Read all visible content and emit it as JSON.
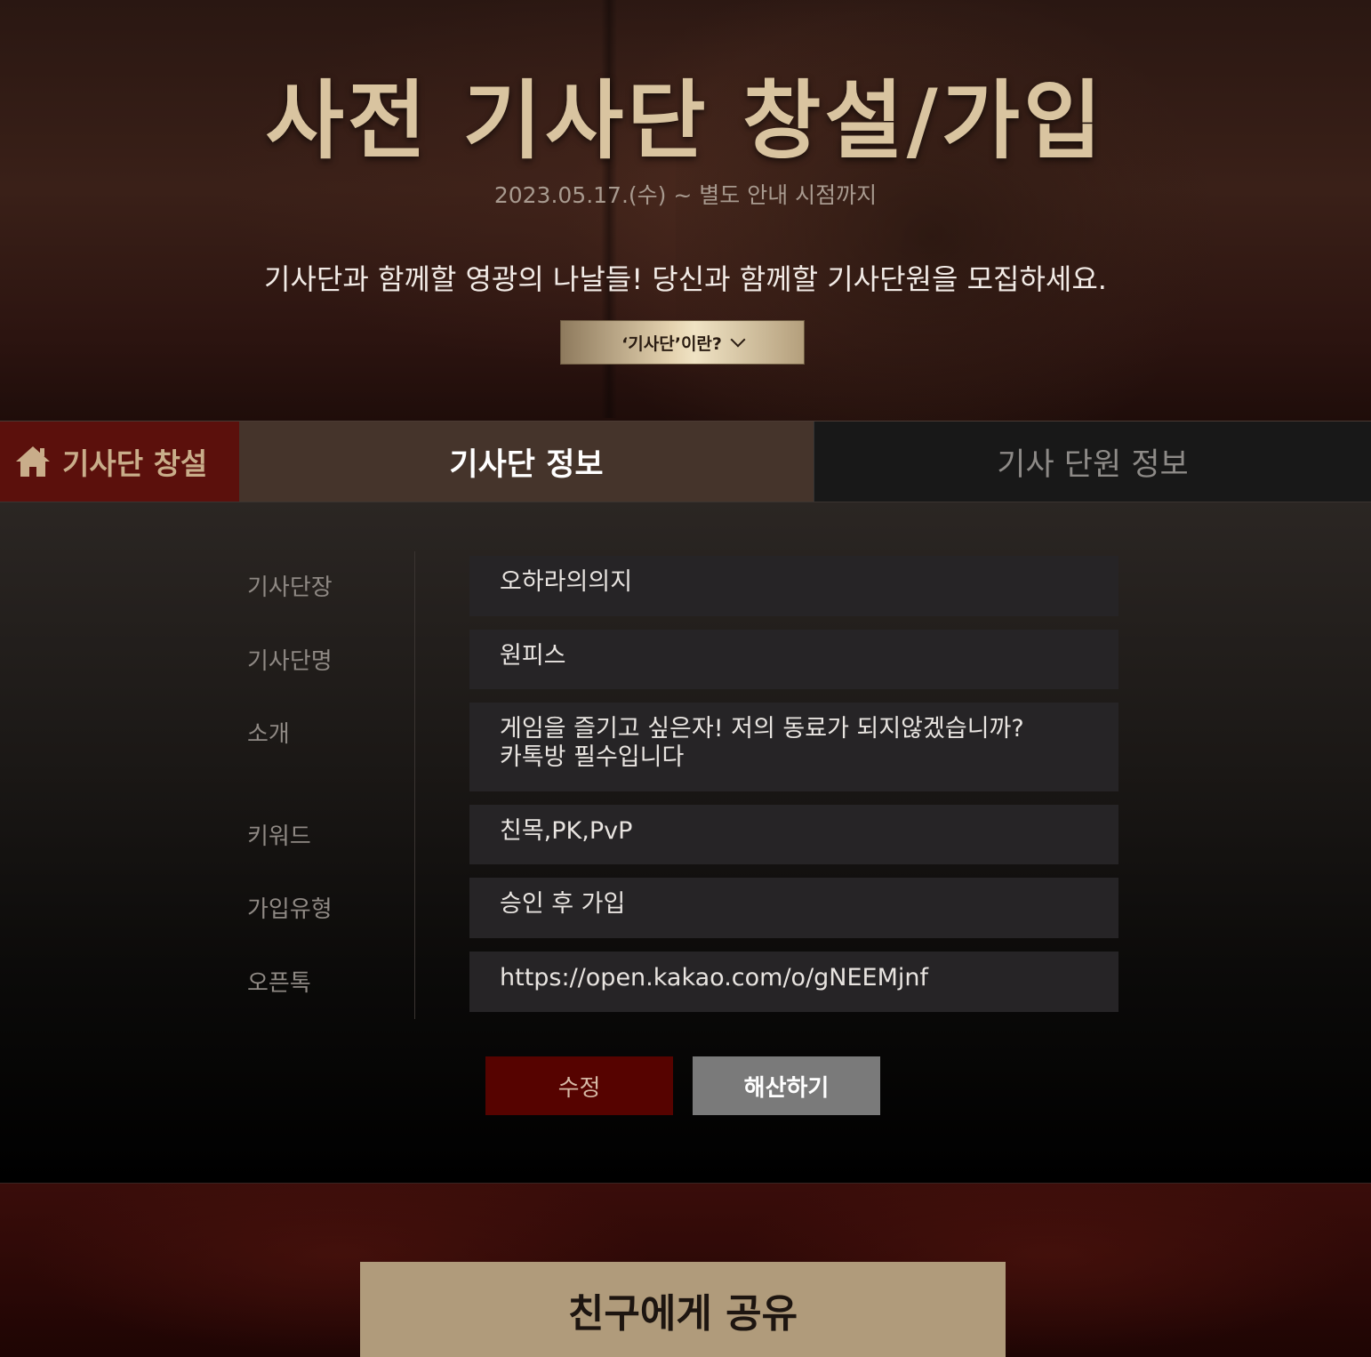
{
  "hero": {
    "title": "사전 기사단 창설/가입",
    "date": "2023.05.17.(수) ~ 별도 안내 시점까지",
    "description": "기사단과 함께할 영광의 나날들! 당신과 함께할 기사단원을 모집하세요.",
    "what_button_label": "‘기사단’이란?"
  },
  "tabs": {
    "create_label": "기사단 창설",
    "info_label": "기사단 정보",
    "members_label": "기사 단원 정보"
  },
  "form": {
    "rows": [
      {
        "label": "기사단장",
        "value": "오하라의의지"
      },
      {
        "label": "기사단명",
        "value": "원피스"
      },
      {
        "label": "소개",
        "lines": [
          "게임을 즐기고 싶은자! 저의 동료가 되지않겠습니까?",
          "카톡방 필수입니다"
        ]
      },
      {
        "label": "키워드",
        "value": "친목,PK,PvP"
      },
      {
        "label": "가입유형",
        "value": "승인 후 가입"
      },
      {
        "label": "오픈톡",
        "value": "https://open.kakao.com/o/gNEEMjnf"
      }
    ],
    "edit_label": "수정",
    "dissolve_label": "해산하기"
  },
  "share": {
    "button_label": "친구에게 공유"
  },
  "colors": {
    "accent_red": "#560300",
    "gold": "#b09b7b",
    "tab_active": "#45342b"
  }
}
